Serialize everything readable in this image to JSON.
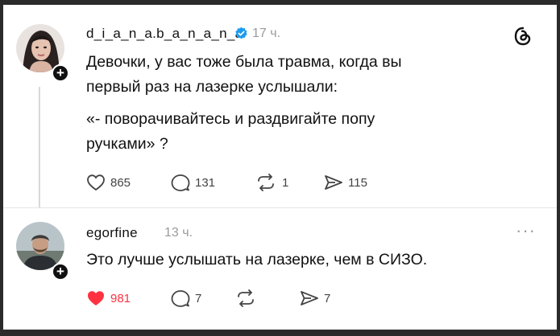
{
  "post1": {
    "username": "d_i_a_n_a.b_a_n_a_n_a",
    "time": "17 ч.",
    "text_line1": "Девочки, у вас тоже была травма, когда вы",
    "text_line2": "первый раз на лазерке услышали:",
    "quote_line1": "«- поворачивайтесь и раздвигайте попу",
    "quote_line2": "ручками» ?",
    "likes": "865",
    "comments": "131",
    "reposts": "1",
    "shares": "115",
    "avatar_icon": "woman-portrait-avatar",
    "verified_color": "#1d9bf0"
  },
  "post2": {
    "username": "egorfine",
    "time": "13 ч.",
    "text": "Это лучше услышать на лазерке, чем в СИЗО.",
    "likes": "981",
    "comments": "7",
    "shares": "7",
    "like_color": "#ff3040",
    "avatar_icon": "man-portrait-avatar"
  }
}
